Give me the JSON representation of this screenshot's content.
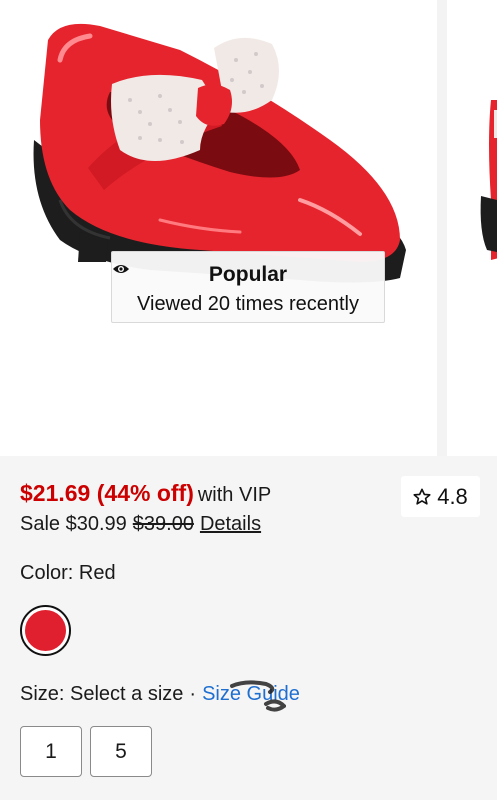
{
  "badge": {
    "icon": "eye-icon",
    "title": "Popular",
    "subtitle": "Viewed 20 times recently"
  },
  "price": {
    "vip_price": "$21.69 (44% off)",
    "vip_label": "with VIP",
    "sale_text": "Sale $30.99",
    "original_price": "$39.00",
    "details_label": "Details"
  },
  "rating": {
    "icon": "star-outline-icon",
    "value": "4.8"
  },
  "color": {
    "label": "Color: Red",
    "swatch_color": "#e0202e"
  },
  "size": {
    "label": "Size: Select a size",
    "separator": "·",
    "guide_label": "Size Guide",
    "options": [
      "1",
      "5"
    ]
  },
  "colors": {
    "sale_red": "#cc0000",
    "link_blue": "#1f6fd1",
    "shoe_red": "#e6242d"
  }
}
